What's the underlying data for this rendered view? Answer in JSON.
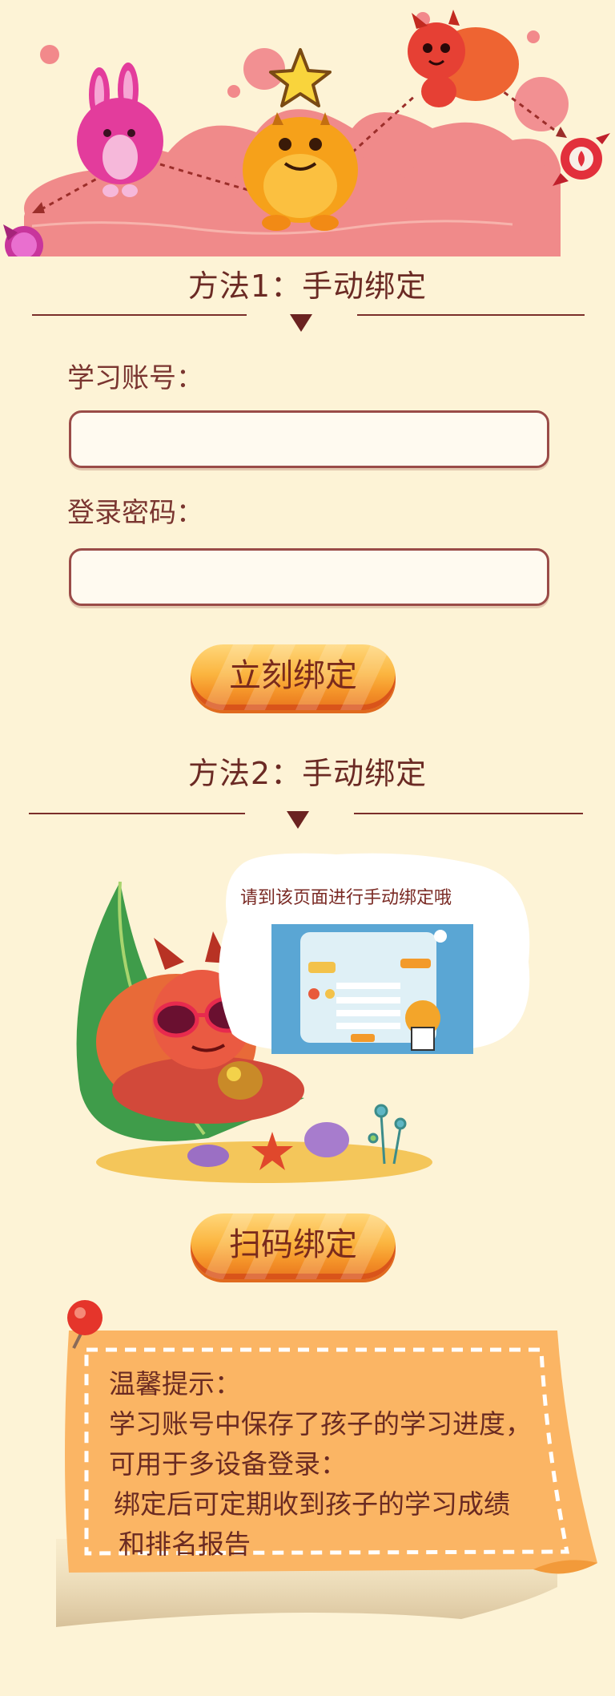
{
  "method1": {
    "title": "方法1：手动绑定",
    "account_label": "学习账号：",
    "account_value": "",
    "password_label": "登录密码：",
    "password_value": "",
    "bind_button": "立刻绑定"
  },
  "method2": {
    "title": "方法2：手动绑定",
    "bubble_text": "请到该页面进行手动绑定哦",
    "scan_button": "扫码绑定"
  },
  "tip": {
    "line1": "温馨提示：",
    "line2": "学习账号中保存了孩子的学习进度，",
    "line3": "可用于多设备登录：",
    "line4": "绑定后可定期收到孩子的学习成绩",
    "line5": "和排名报告"
  },
  "colors": {
    "background": "#fdf3d6",
    "title_text": "#6b2a24",
    "button_orange": "#f5962a",
    "note_orange": "#fbb564",
    "pin_red": "#e5352b"
  }
}
